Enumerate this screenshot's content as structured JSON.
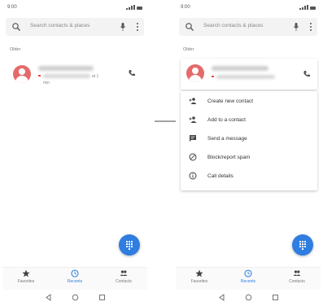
{
  "status": {
    "time": "9:00"
  },
  "search": {
    "placeholder": "Search contacts & places"
  },
  "list": {
    "section_label": "Older",
    "call_meta_suffix": "at 1",
    "call_meta_unit": "min"
  },
  "context_menu": {
    "items": [
      {
        "label": "Create new contact",
        "icon": "add-person-icon"
      },
      {
        "label": "Add to a contact",
        "icon": "add-to-contact-icon"
      },
      {
        "label": "Send a message",
        "icon": "message-icon"
      },
      {
        "label": "Block/report spam",
        "icon": "block-icon"
      },
      {
        "label": "Call details",
        "icon": "info-icon"
      }
    ]
  },
  "bottom_nav": {
    "tabs": [
      {
        "label": "Favorites",
        "icon": "star-icon"
      },
      {
        "label": "Recents",
        "icon": "clock-icon",
        "active": true
      },
      {
        "label": "Contacts",
        "icon": "people-icon"
      }
    ]
  },
  "colors": {
    "accent": "#2f7de1",
    "avatar": "#e56b6b"
  }
}
